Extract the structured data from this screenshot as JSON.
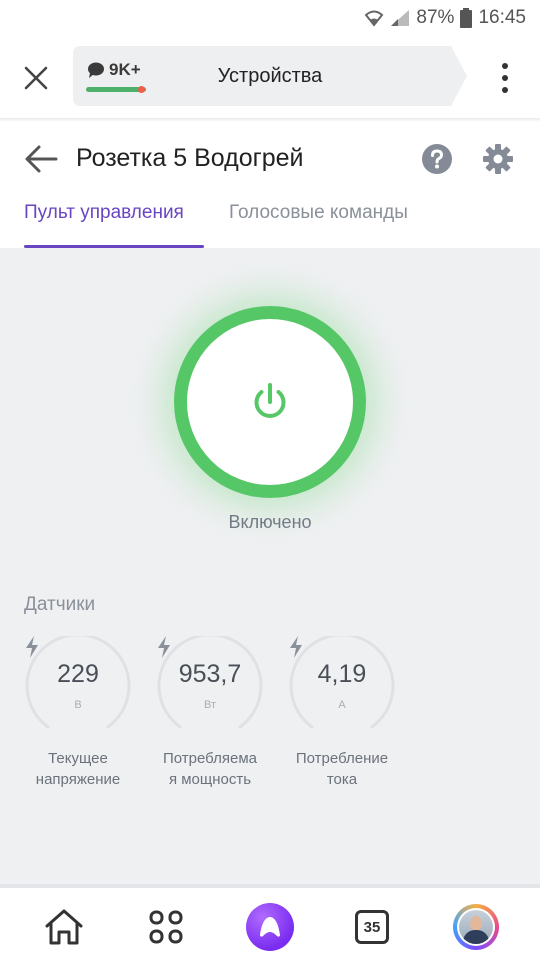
{
  "status_bar": {
    "battery": "87%",
    "time": "16:45",
    "icons": [
      "wifi-icon",
      "signal-icon",
      "battery-icon"
    ]
  },
  "app_bar": {
    "chat_count": "9K+",
    "title": "Устройства",
    "icons": [
      "close-icon",
      "chat-icon",
      "more-vertical-icon"
    ]
  },
  "page": {
    "title": "Розетка 5 Водогрей",
    "tabs": [
      {
        "label": "Пульт управления",
        "active": true
      },
      {
        "label": "Голосовые команды",
        "active": false
      }
    ],
    "icons": [
      "back-arrow-icon",
      "help-icon",
      "gear-icon"
    ]
  },
  "power": {
    "state": "Включено",
    "on": true,
    "accent_color": "#56c766"
  },
  "sensors": {
    "title": "Датчики",
    "items": [
      {
        "value": "229",
        "unit": "В",
        "label": "Текущее напряжение",
        "label_lines": [
          "Текущее",
          "напряжение"
        ]
      },
      {
        "value": "953,7",
        "unit": "Вт",
        "label": "Потребляемая мощность",
        "label_lines": [
          "Потребляема",
          "я мощность"
        ]
      },
      {
        "value": "4,19",
        "unit": "А",
        "label": "Потребление тока",
        "label_lines": [
          "Потребление",
          "тока"
        ]
      }
    ]
  },
  "bottom_nav": {
    "calendar_day": "35",
    "icons": [
      "home-icon",
      "apps-grid-icon",
      "alice-icon",
      "calendar-icon",
      "avatar"
    ]
  },
  "colors": {
    "accent": "#6a45c2",
    "power_on": "#56c766",
    "alice": "#7a2df0",
    "background": "#eff0f2"
  }
}
